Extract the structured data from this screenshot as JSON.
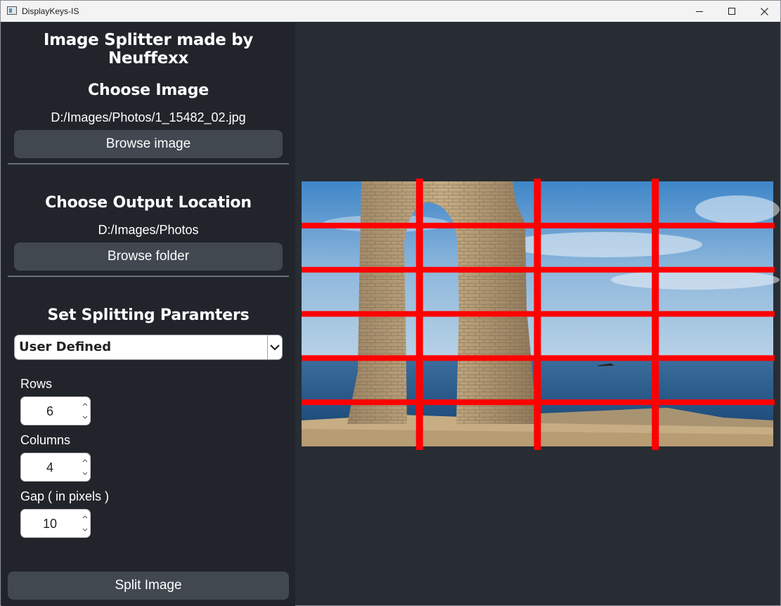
{
  "window": {
    "title": "DisplayKeys-IS",
    "controls": [
      "minimize-icon",
      "maximize-icon",
      "close-icon"
    ]
  },
  "sidebar": {
    "app_title": "Image Splitter made by Neuffexx",
    "choose_image": {
      "heading": "Choose Image",
      "path": "D:/Images/Photos/1_15482_02.jpg",
      "button_label": "Browse image"
    },
    "choose_output": {
      "heading": "Choose Output Location",
      "path": "D:/Images/Photos",
      "button_label": "Browse folder"
    },
    "params": {
      "heading": "Set Splitting Paramters",
      "preset": "User Defined",
      "rows_label": "Rows",
      "rows_value": "6",
      "columns_label": "Columns",
      "columns_value": "4",
      "gap_label": "Gap ( in pixels )",
      "gap_value": "10"
    },
    "split_button_label": "Split Image"
  },
  "preview": {
    "rows": 6,
    "columns": 4,
    "gap": 10,
    "grid_color": "#ff0000"
  },
  "colors": {
    "window_bg": "#282d33",
    "sidebar_bg": "#21252b",
    "button_bg": "#414850",
    "text": "#ffffff"
  }
}
